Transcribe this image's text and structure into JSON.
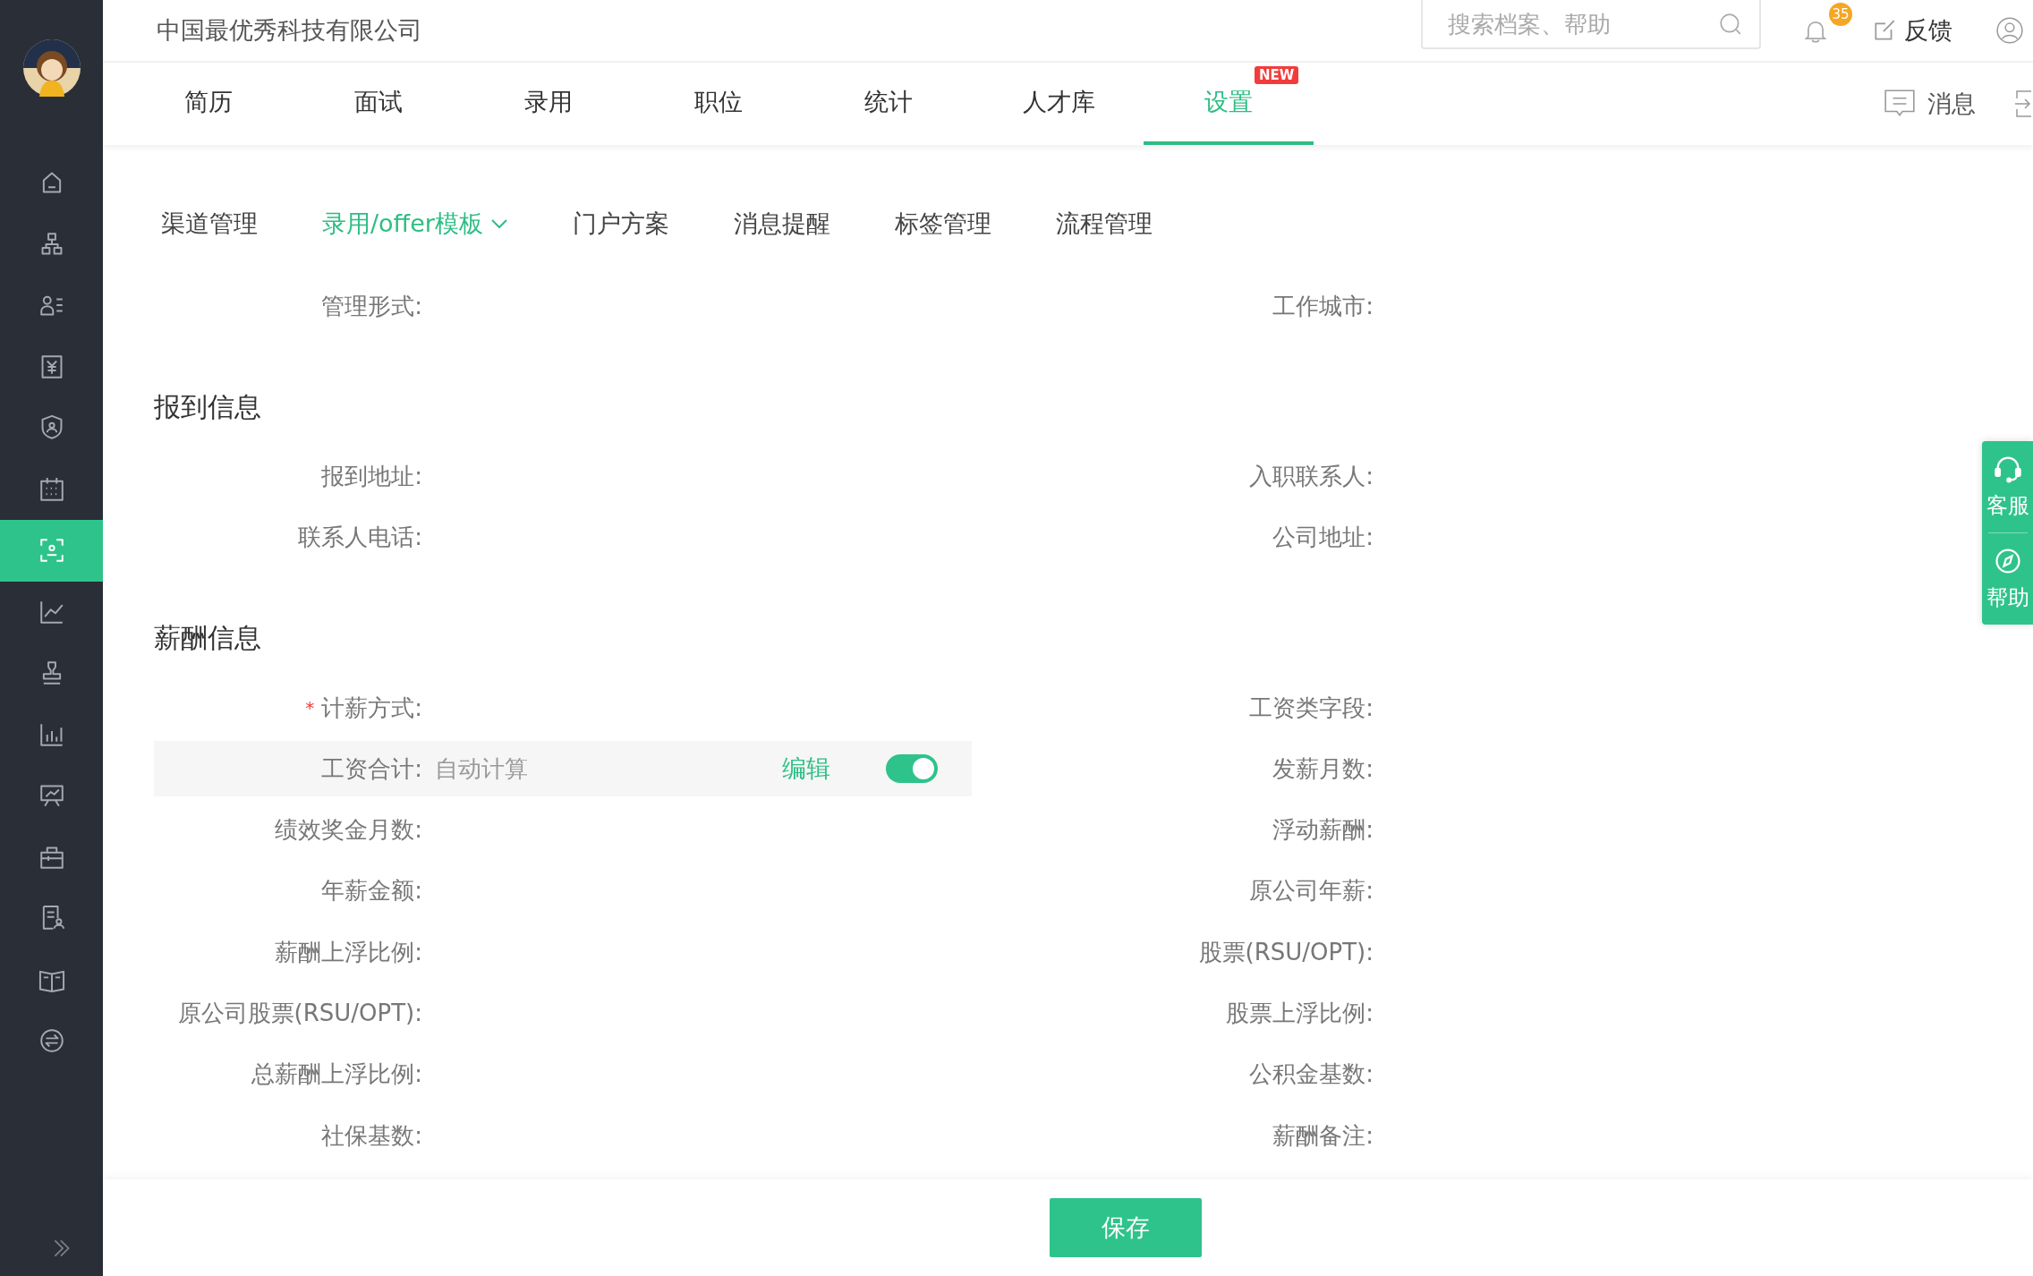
{
  "header": {
    "company": "中国最优秀科技有限公司",
    "search": {
      "placeholder": "搜索档案、帮助"
    },
    "notification_count": "35",
    "feedback": "反馈"
  },
  "sidebar": {
    "items": [
      {
        "selected": false
      },
      {
        "selected": false
      },
      {
        "selected": false
      },
      {
        "selected": false
      },
      {
        "selected": false
      },
      {
        "selected": false
      },
      {
        "selected": true
      },
      {
        "selected": false
      },
      {
        "selected": false
      },
      {
        "selected": false
      },
      {
        "selected": false
      },
      {
        "selected": false
      },
      {
        "selected": false
      },
      {
        "selected": false
      },
      {
        "selected": false
      }
    ]
  },
  "tabs": [
    {
      "label": "简历",
      "selected": false
    },
    {
      "label": "面试",
      "selected": false
    },
    {
      "label": "录用",
      "selected": false
    },
    {
      "label": "职位",
      "selected": false
    },
    {
      "label": "统计",
      "selected": false
    },
    {
      "label": "人才库",
      "selected": false
    },
    {
      "label": "设置",
      "selected": true,
      "badge": "NEW"
    }
  ],
  "messages": "消息",
  "sub_tabs": [
    {
      "label": "渠道管理",
      "selected": false,
      "has_menu": false
    },
    {
      "label": "录用/offer模板",
      "selected": true,
      "has_menu": true
    },
    {
      "label": "门户方案",
      "selected": false,
      "has_menu": false
    },
    {
      "label": "消息提醒",
      "selected": false,
      "has_menu": false
    },
    {
      "label": "标签管理",
      "selected": false,
      "has_menu": false
    },
    {
      "label": "流程管理",
      "selected": false,
      "has_menu": false
    }
  ],
  "sections": [
    {
      "rows": [
        {
          "left": {
            "label": "管理形式:",
            "kind": "plain"
          },
          "right": {
            "label": "工作城市:",
            "kind": "plain"
          }
        }
      ]
    },
    {
      "title": "报到信息",
      "rows": [
        {
          "left": {
            "label": "报到地址:",
            "kind": "plain"
          },
          "right": {
            "label": "入职联系人:",
            "kind": "plain"
          }
        },
        {
          "left": {
            "label": "联系人电话:",
            "kind": "plain"
          },
          "right": {
            "label": "公司地址:",
            "kind": "plain"
          }
        }
      ]
    },
    {
      "title": "薪酬信息",
      "rows": [
        {
          "left": {
            "label": "计薪方式:",
            "required_mark": "*",
            "kind": "plain"
          },
          "right": {
            "label": "工资类字段:",
            "kind": "plain"
          }
        },
        {
          "left": {
            "label": "工资合计:",
            "kind": "toggle",
            "value": "自动计算",
            "action": "编辑",
            "on": true
          },
          "right": {
            "label": "发薪月数:",
            "kind": "plain"
          }
        },
        {
          "left": {
            "label": "绩效奖金月数:",
            "kind": "plain"
          },
          "right": {
            "label": "浮动薪酬:",
            "kind": "plain"
          }
        },
        {
          "left": {
            "label": "年薪金额:",
            "kind": "plain"
          },
          "right": {
            "label": "原公司年薪:",
            "kind": "plain"
          }
        },
        {
          "left": {
            "label": "薪酬上浮比例:",
            "kind": "plain"
          },
          "right": {
            "label": "股票(RSU/OPT):",
            "kind": "plain"
          }
        },
        {
          "left": {
            "label": "原公司股票(RSU/OPT):",
            "kind": "plain"
          },
          "right": {
            "label": "股票上浮比例:",
            "kind": "plain"
          }
        },
        {
          "left": {
            "label": "总薪酬上浮比例:",
            "kind": "plain"
          },
          "right": {
            "label": "公积金基数:",
            "kind": "plain"
          }
        },
        {
          "left": {
            "label": "社保基数:",
            "kind": "plain"
          },
          "right": {
            "label": "薪酬备注:",
            "kind": "plain"
          }
        }
      ]
    }
  ],
  "float_panel": [
    {
      "label": "客服"
    },
    {
      "label": "帮助"
    }
  ],
  "footer": {
    "save": "保存"
  }
}
